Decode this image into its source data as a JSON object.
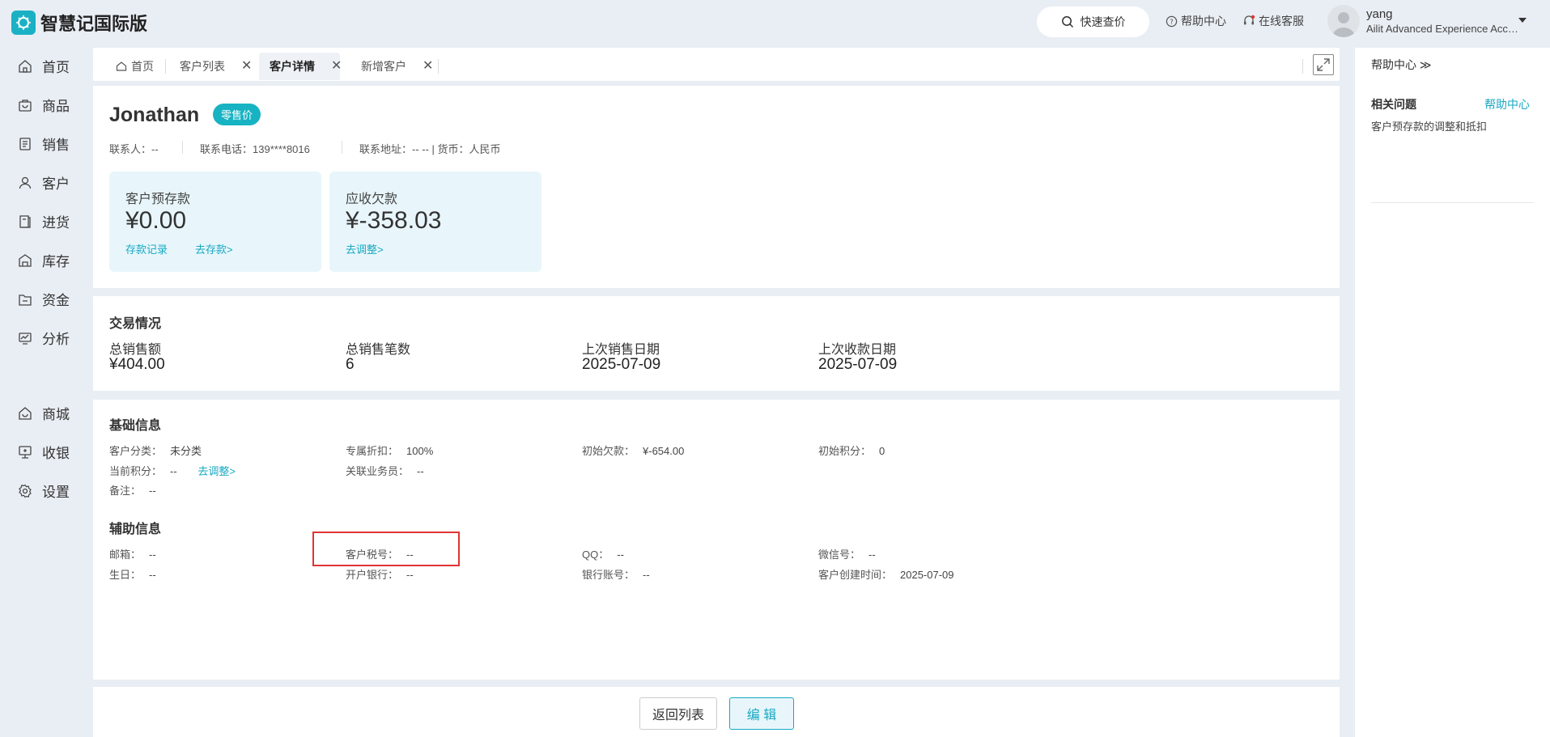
{
  "app": {
    "title": "智慧记国际版"
  },
  "header": {
    "quick_search": "快速查价",
    "help_center": "帮助中心",
    "online_service": "在线客服",
    "user_name": "yang",
    "user_org": "Ailit Advanced Experience Acco..."
  },
  "sidebar": {
    "items": [
      {
        "label": "首页",
        "icon": "home-icon"
      },
      {
        "label": "商品",
        "icon": "bag-icon"
      },
      {
        "label": "销售",
        "icon": "document-icon"
      },
      {
        "label": "客户",
        "icon": "user-icon"
      },
      {
        "label": "进货",
        "icon": "book-icon"
      },
      {
        "label": "库存",
        "icon": "warehouse-icon"
      },
      {
        "label": "资金",
        "icon": "folder-icon"
      },
      {
        "label": "分析",
        "icon": "monitor-icon"
      },
      {
        "label": "商城",
        "icon": "store-icon"
      },
      {
        "label": "收银",
        "icon": "cashier-icon"
      },
      {
        "label": "设置",
        "icon": "gear-icon"
      }
    ]
  },
  "tabs": [
    {
      "label": "首页"
    },
    {
      "label": "客户列表"
    },
    {
      "label": "客户详情"
    },
    {
      "label": "新增客户"
    }
  ],
  "customer": {
    "name": "Jonathan",
    "price_badge": "零售价",
    "contact_label": "联系人：",
    "contact_value": "--",
    "phone_label": "联系电话：",
    "phone_value": "139****8016",
    "address_label": "联系地址：",
    "address_value": "-- -- | 货币：人民币"
  },
  "balances": {
    "prepaid_label": "客户预存款",
    "prepaid_value": "¥0.00",
    "deposit_record": "存款记录",
    "go_deposit": "去存款>",
    "receivable_label": "应收欠款",
    "receivable_value": "¥-358.03",
    "go_adjust": "去调整>"
  },
  "transactions": {
    "title": "交易情况",
    "total_sales_label": "总销售额",
    "total_sales_value": "¥404.00",
    "total_count_label": "总销售笔数",
    "total_count_value": "6",
    "last_sale_label": "上次销售日期",
    "last_sale_value": "2025-07-09",
    "last_payment_label": "上次收款日期",
    "last_payment_value": "2025-07-09"
  },
  "basic_info": {
    "title": "基础信息",
    "category_label": "客户分类：",
    "category_value": "未分类",
    "discount_label": "专属折扣：",
    "discount_value": "100%",
    "initial_debt_label": "初始欠款：",
    "initial_debt_value": "¥-654.00",
    "initial_points_label": "初始积分：",
    "initial_points_value": "0",
    "current_points_label": "当前积分：",
    "current_points_value": "--",
    "adjust_link": "去调整>",
    "salesperson_label": "关联业务员：",
    "salesperson_value": "--",
    "remark_label": "备注：",
    "remark_value": "--"
  },
  "extra_info": {
    "title": "辅助信息",
    "email_label": "邮箱：",
    "email_value": "--",
    "tax_label": "客户税号：",
    "tax_value": "--",
    "qq_label": "QQ：",
    "qq_value": "--",
    "wechat_label": "微信号：",
    "wechat_value": "--",
    "birthday_label": "生日：",
    "birthday_value": "--",
    "bank_label": "开户银行：",
    "bank_value": "--",
    "account_label": "银行账号：",
    "account_value": "--",
    "created_label": "客户创建时间：",
    "created_value": "2025-07-09"
  },
  "footer": {
    "back_label": "返回列表",
    "edit_label": "编 辑"
  },
  "help_panel": {
    "header": "帮助中心 ≫",
    "related_title": "相关问题",
    "help_link": "帮助中心",
    "item": "客户预存款的调整和抵扣"
  },
  "colors": {
    "accent": "#17b3c3",
    "highlight": "#e03434",
    "background": "#e9eef4"
  }
}
